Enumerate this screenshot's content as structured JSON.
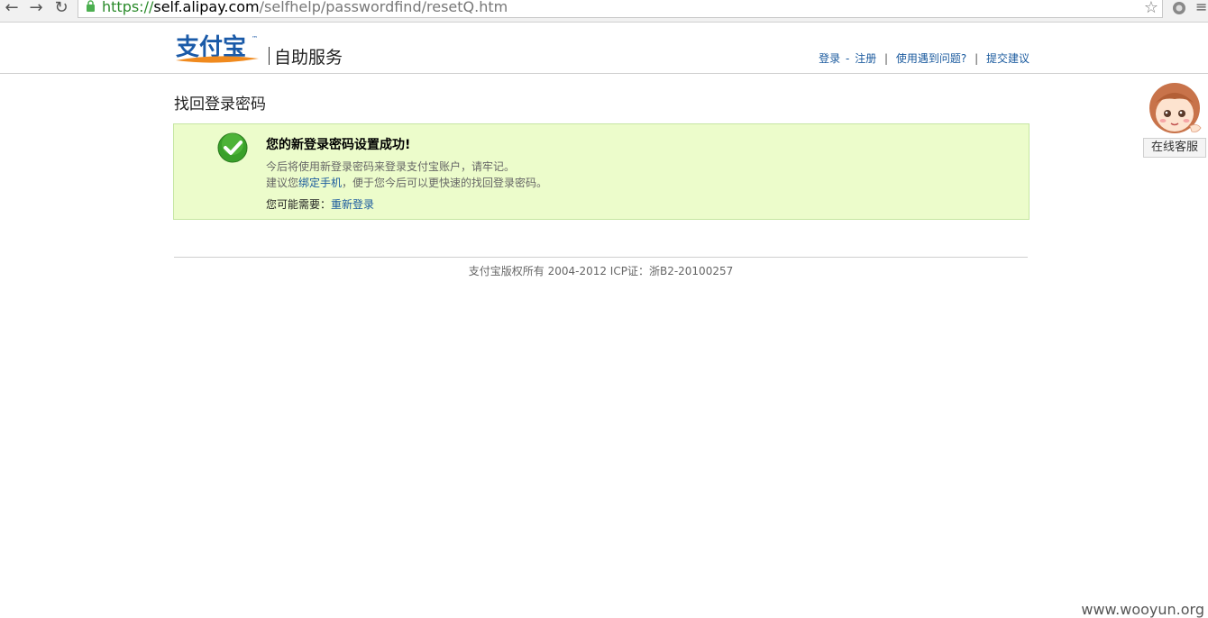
{
  "browser": {
    "url_scheme": "https://",
    "url_host": "self.alipay.com",
    "url_path": "/selfhelp/passwordfind/resetQ.htm",
    "back_icon": "←",
    "forward_icon": "→",
    "reload_icon": "↻",
    "star_icon": "☆",
    "menu_icon": "≡"
  },
  "header": {
    "logo_text": "支付宝",
    "logo_tm": "™",
    "title": "自助服务",
    "links": {
      "login": "登录",
      "dash": "-",
      "register": "注册",
      "help": "使用遇到问题?",
      "feedback": "提交建议",
      "sep": "|"
    }
  },
  "main": {
    "heading": "找回登录密码",
    "notice": {
      "title": "您的新登录密码设置成功!",
      "line1": "今后将使用新登录密码来登录支付宝账户，请牢记。",
      "line2_prefix": "建议您",
      "line2_link": "绑定手机",
      "line2_suffix": "，便于您今后可以更快速的找回登录密码。",
      "next_label": "您可能需要：",
      "next_link": "重新登录"
    }
  },
  "footer": {
    "text": "支付宝版权所有 2004-2012 ICP证：浙B2-20100257"
  },
  "customer_service": {
    "label": "在线客服"
  },
  "watermark": "www.wooyun.org",
  "colors": {
    "link": "#1a5a9e",
    "notice_bg": "#ecfccb",
    "notice_border": "#c6e6a2",
    "check_green": "#3aa02a",
    "logo_blue": "#1a5aa8",
    "logo_orange": "#f08a1e"
  }
}
